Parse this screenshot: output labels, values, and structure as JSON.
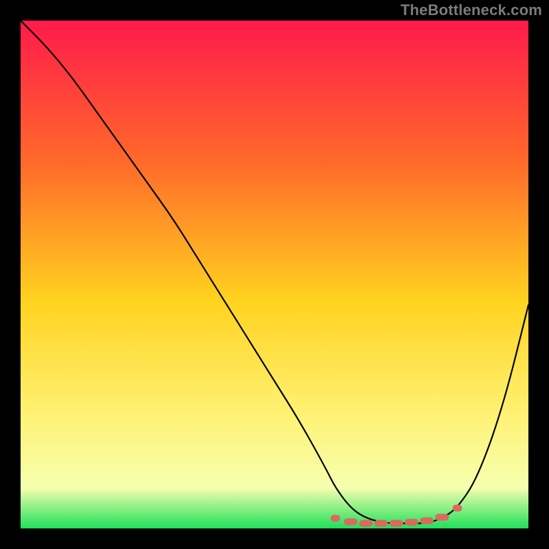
{
  "watermark": "TheBottleneck.com",
  "colors": {
    "bg": "#000000",
    "gradient_top": "#ff1a4b",
    "gradient_mid1": "#ff6a2a",
    "gradient_mid2": "#ffd21f",
    "gradient_mid3": "#fff275",
    "gradient_low": "#f6ffb0",
    "gradient_bottom": "#1fe05a",
    "curve": "#000000",
    "marker": "#d96a5f"
  },
  "chart_data": {
    "type": "line",
    "title": "",
    "xlabel": "",
    "ylabel": "",
    "xlim": [
      0,
      100
    ],
    "ylim": [
      0,
      100
    ],
    "x": [
      0,
      5,
      10,
      15,
      20,
      25,
      30,
      35,
      40,
      45,
      50,
      55,
      60,
      62,
      65,
      68,
      72,
      76,
      80,
      83,
      86,
      90,
      95,
      100
    ],
    "values": [
      100,
      95,
      89,
      82,
      75,
      68,
      61,
      53,
      45,
      37,
      29,
      21,
      12,
      8,
      4,
      2,
      1,
      1,
      1,
      2,
      4,
      10,
      24,
      44
    ],
    "markers_x": [
      62,
      65,
      68,
      71,
      74,
      77,
      80,
      83,
      86
    ],
    "markers_y": [
      2,
      1.3,
      1,
      1,
      1,
      1.2,
      1.5,
      2.2,
      4
    ]
  }
}
